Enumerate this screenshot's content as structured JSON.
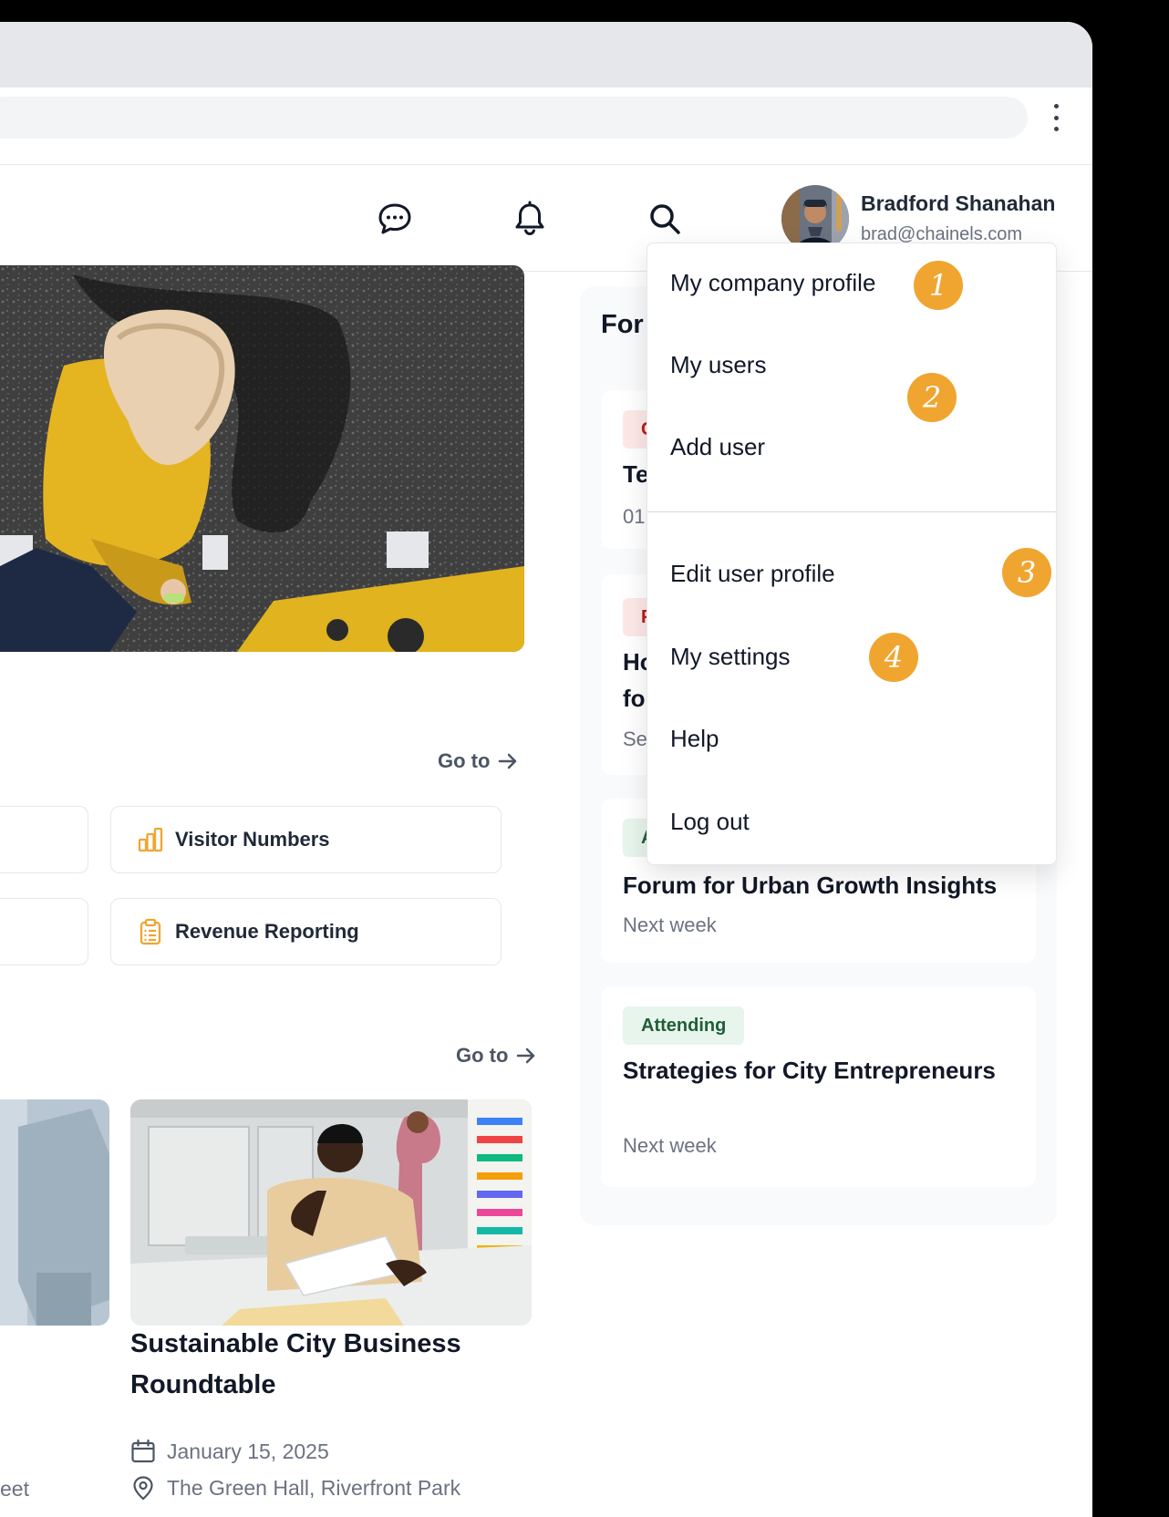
{
  "header": {
    "icons": [
      "chat-icon",
      "bell-icon",
      "search-icon"
    ],
    "user": {
      "name": "Bradford Shanahan",
      "email": "brad@chainels.com"
    }
  },
  "main": {
    "goto_label": "Go to",
    "quick_links": [
      {
        "label": "Visitor Numbers",
        "icon": "bar-chart-icon"
      },
      {
        "label": "Revenue Reporting",
        "icon": "clipboard-icon"
      }
    ],
    "event": {
      "title": "Sustainable City Business Roundtable",
      "date": "January 15, 2025",
      "location": "The Green Hall, Riverfront Park",
      "left_partial": "eet"
    }
  },
  "panel": {
    "title": "For",
    "cards": [
      {
        "tag": "C",
        "title": "Te",
        "sub": "01"
      },
      {
        "tag": "P",
        "title_line1": "Ho",
        "title_line2": "fo",
        "sub": "Se"
      },
      {
        "tag": "A",
        "title": "Forum for Urban Growth Insights",
        "sub": "Next week"
      },
      {
        "tag": "Attending",
        "title": "Strategies for City Entrepreneurs",
        "sub": "Next week"
      }
    ]
  },
  "menu": {
    "items": [
      {
        "label": "My company profile"
      },
      {
        "label": "My users"
      },
      {
        "label": "Add user"
      },
      {
        "label": "Edit user profile"
      },
      {
        "label": "My settings"
      },
      {
        "label": "Help"
      },
      {
        "label": "Log out"
      }
    ],
    "badges": [
      "1",
      "2",
      "3",
      "4"
    ]
  },
  "colors": {
    "accent": "#f0a530",
    "tag_green_bg": "#e8f5ec",
    "tag_green_text": "#1f5e37",
    "tag_red_bg": "#fde8e8",
    "tag_red_text": "#b91c1c"
  }
}
